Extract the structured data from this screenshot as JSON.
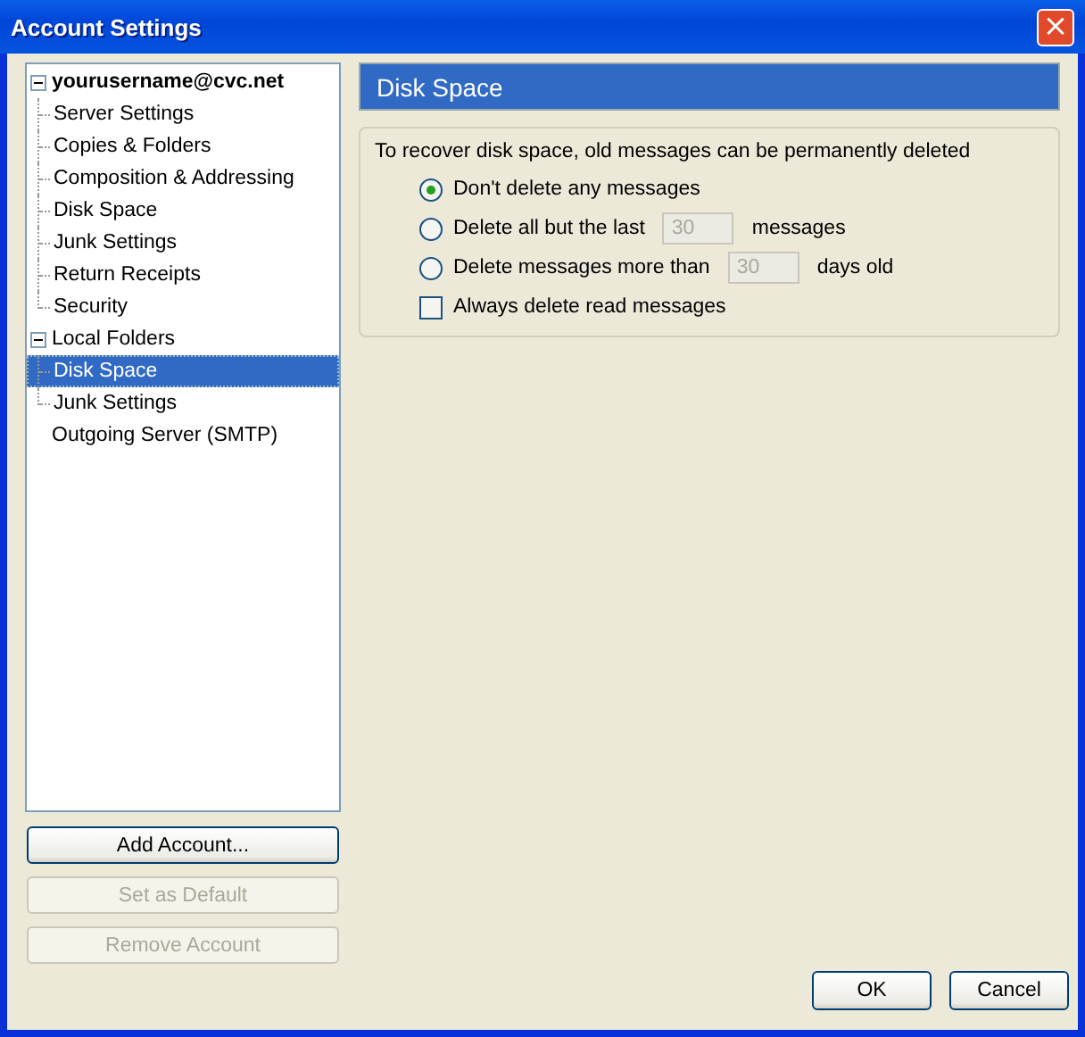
{
  "window": {
    "title": "Account Settings",
    "close": "×"
  },
  "tree": [
    {
      "label": "yourusername@cvc.net",
      "bold": true,
      "expanded": true,
      "selected": false,
      "children": [
        {
          "label": "Server Settings",
          "selected": false
        },
        {
          "label": "Copies & Folders",
          "selected": false
        },
        {
          "label": "Composition & Addressing",
          "selected": false
        },
        {
          "label": "Disk Space",
          "selected": false
        },
        {
          "label": "Junk Settings",
          "selected": false
        },
        {
          "label": "Return Receipts",
          "selected": false
        },
        {
          "label": "Security",
          "selected": false
        }
      ]
    },
    {
      "label": "Local Folders",
      "bold": false,
      "expanded": true,
      "selected": false,
      "children": [
        {
          "label": "Disk Space",
          "selected": true
        },
        {
          "label": "Junk Settings",
          "selected": false
        }
      ]
    },
    {
      "label": "Outgoing Server (SMTP)",
      "bold": false,
      "selected": false
    }
  ],
  "account_buttons": [
    {
      "label": "Add Account...",
      "disabled": false
    },
    {
      "label": "Set as Default",
      "disabled": true
    },
    {
      "label": "Remove Account",
      "disabled": true
    }
  ],
  "panel": {
    "title": "Disk Space",
    "intro": "To recover disk space, old messages can be permanently deleted",
    "options": [
      {
        "kind": "radio",
        "label": "Don't delete any messages",
        "selected": true
      },
      {
        "kind": "radio",
        "label": "Delete all but the last",
        "selected": false,
        "field": {
          "value": "30",
          "disabled": true
        },
        "suffix": "messages"
      },
      {
        "kind": "radio",
        "label": "Delete messages more than",
        "selected": false,
        "field": {
          "value": "30",
          "disabled": true
        },
        "suffix": "days old"
      },
      {
        "kind": "checkbox",
        "label": "Always delete read messages",
        "checked": false
      }
    ]
  },
  "dialog_buttons": [
    {
      "label": "OK"
    },
    {
      "label": "Cancel"
    }
  ]
}
